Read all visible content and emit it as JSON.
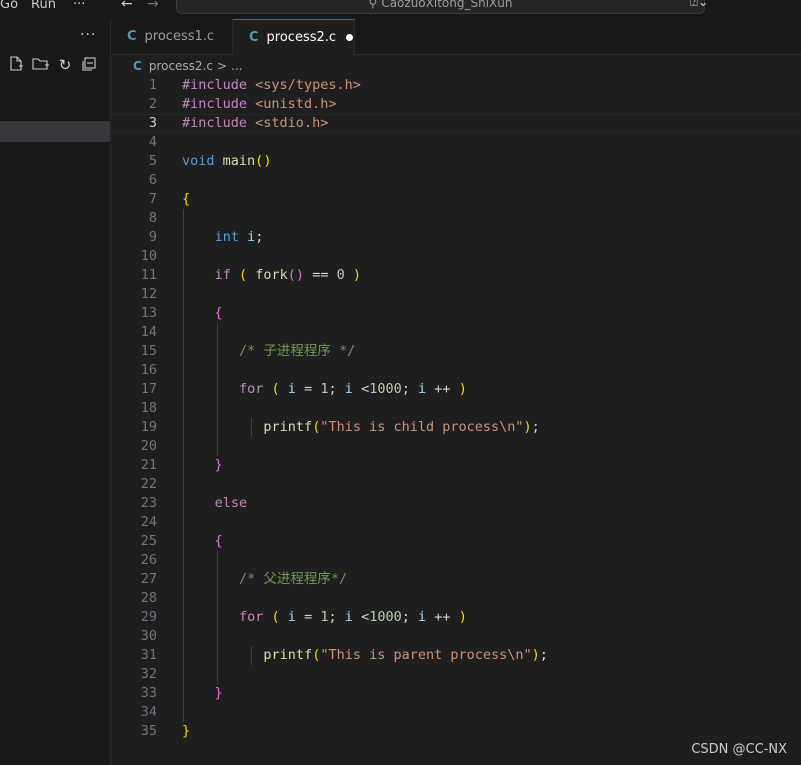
{
  "titlebar": {
    "menu": [
      "Go",
      "Run",
      "···"
    ],
    "search_text": "CaozuoXitong_ShiXun"
  },
  "sidebar": {
    "more": "···"
  },
  "tabs": [
    {
      "label": "process1.c",
      "icon": "C",
      "active": false
    },
    {
      "label": "process2.c",
      "icon": "C",
      "active": true,
      "modified": true
    }
  ],
  "breadcrumb": {
    "icon": "C",
    "file": "process2.c",
    "sep": ">",
    "rest": "..."
  },
  "editor": {
    "current_line": 3,
    "lines": [
      "#include <sys/types.h>",
      "#include <unistd.h>",
      "#include <stdio.h>",
      "",
      "void main()",
      "",
      "{",
      "",
      "    int i;",
      "",
      "    if ( fork() == 0 )",
      "",
      "    {",
      "",
      "       /* 子进程程序 */",
      "",
      "       for ( i = 1; i <1000; i ++ )",
      "",
      "          printf(\"This is child process\\n\");",
      "",
      "    }",
      "",
      "    else",
      "",
      "    {",
      "",
      "       /* 父进程程序*/",
      "",
      "       for ( i = 1; i <1000; i ++ )",
      "",
      "          printf(\"This is parent process\\n\");",
      "",
      "    }",
      "",
      "}"
    ]
  },
  "watermark": "CSDN @CC-NX",
  "colors": {
    "accent": "#0078d4",
    "editor_bg": "#1f1f1f",
    "sidebar_bg": "#181818"
  }
}
